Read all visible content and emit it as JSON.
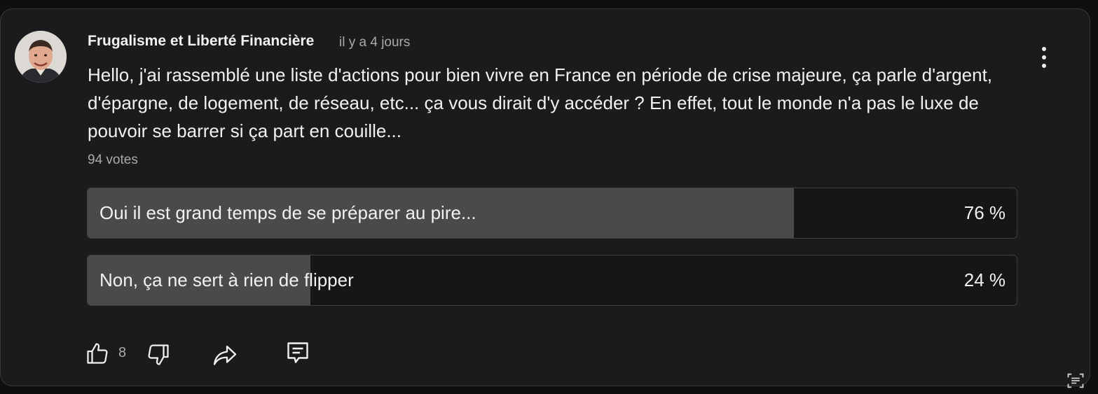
{
  "comment": {
    "author": "Frugalisme et Liberté Financière",
    "time": "il y a 4 jours",
    "text": "Hello, j'ai rassemblé une liste d'actions pour bien vivre en France en période de crise majeure, ça parle d'argent, d'épargne, de logement, de réseau, etc... ça vous dirait d'y accéder ? En effet, tout le monde n'a pas le luxe de pouvoir se barrer si ça part en couille...",
    "votes": "94 votes"
  },
  "poll": {
    "options": [
      {
        "label": "Oui il est grand temps de se préparer au pire...",
        "percent_text": "76 %",
        "fraction": 0.76
      },
      {
        "label": "Non, ça ne sert à rien de flipper",
        "percent_text": "24 %",
        "fraction": 0.24
      }
    ]
  },
  "actions": {
    "like_count": "8",
    "icons": [
      "thumbs-up-icon",
      "thumbs-down-icon",
      "share-icon",
      "reply-icon",
      "more-vert-icon",
      "text-scan-icon"
    ]
  },
  "colors": {
    "background": "#0f0f0f",
    "card": "#1b1a1d",
    "poll_fill": "#4a4a4c",
    "secondary_text": "#aaaaaa"
  }
}
